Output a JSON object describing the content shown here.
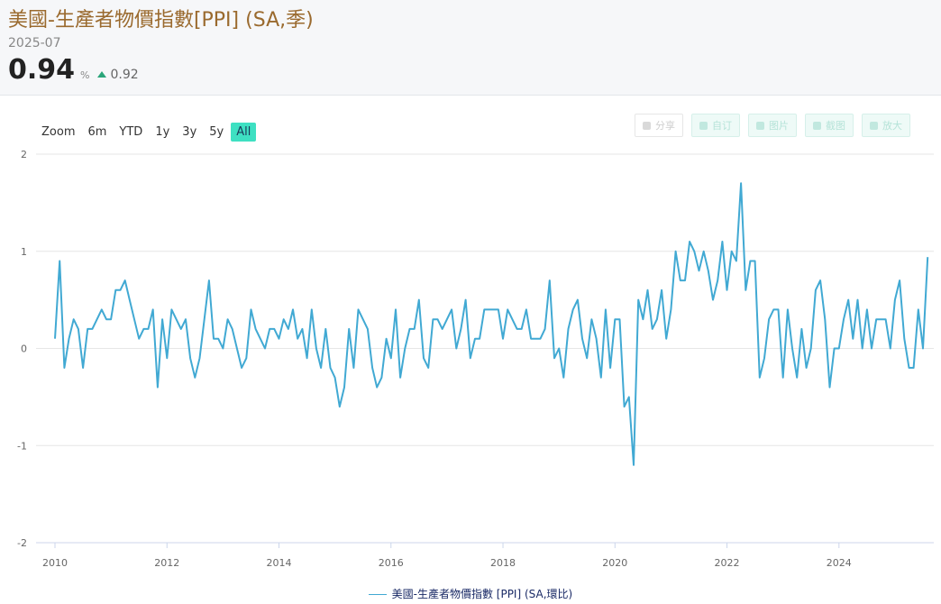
{
  "header": {
    "title": "美國-生產者物價指數[PPI] (SA,季)",
    "date": "2025-07",
    "value": "0.94",
    "unit": "%",
    "previous": "0.92",
    "trend_color": "#2aa57a"
  },
  "zoom": {
    "label": "Zoom",
    "options": [
      "6m",
      "YTD",
      "1y",
      "3y",
      "5y",
      "All"
    ],
    "active": "All"
  },
  "toolbar": {
    "share": "分享",
    "custom": "自订",
    "image": "图片",
    "screenshot": "截图",
    "enlarge": "放大"
  },
  "legend": {
    "label": "美國-生產者物價指數 [PPI] (SA,環比)"
  },
  "chart_data": {
    "type": "line",
    "title": "",
    "xlabel": "",
    "ylabel": "",
    "series_color": "#41a9d3",
    "xlim": [
      "2010-01",
      "2025-07"
    ],
    "ylim": [
      -2,
      2
    ],
    "x_ticks": [
      "2010",
      "2012",
      "2014",
      "2016",
      "2018",
      "2020",
      "2022",
      "2024"
    ],
    "y_ticks": [
      "2",
      "1",
      "0",
      "-1",
      "-2"
    ],
    "grid": "horizontal",
    "legend_position": "bottom-center",
    "series": [
      {
        "name": "美國-生產者物價指數 [PPI] (SA,環比)",
        "start": "2010-01",
        "frequency": "monthly",
        "values": [
          0.1,
          0.9,
          -0.2,
          0.1,
          0.3,
          0.2,
          -0.2,
          0.2,
          0.2,
          0.3,
          0.4,
          0.3,
          0.3,
          0.6,
          0.6,
          0.7,
          0.5,
          0.3,
          0.1,
          0.2,
          0.2,
          0.4,
          -0.4,
          0.3,
          -0.1,
          0.4,
          0.3,
          0.2,
          0.3,
          -0.1,
          -0.3,
          -0.1,
          0.3,
          0.7,
          0.1,
          0.1,
          0.0,
          0.3,
          0.2,
          0.0,
          -0.2,
          -0.1,
          0.4,
          0.2,
          0.1,
          0.0,
          0.2,
          0.2,
          0.1,
          0.3,
          0.2,
          0.4,
          0.1,
          0.2,
          -0.1,
          0.4,
          0.0,
          -0.2,
          0.2,
          -0.2,
          -0.3,
          -0.6,
          -0.4,
          0.2,
          -0.2,
          0.4,
          0.3,
          0.2,
          -0.2,
          -0.4,
          -0.3,
          0.1,
          -0.1,
          0.4,
          -0.3,
          0.0,
          0.2,
          0.2,
          0.5,
          -0.1,
          -0.2,
          0.3,
          0.3,
          0.2,
          0.3,
          0.4,
          0.0,
          0.2,
          0.5,
          -0.1,
          0.1,
          0.1,
          0.4,
          0.4,
          0.4,
          0.4,
          0.1,
          0.4,
          0.3,
          0.2,
          0.2,
          0.4,
          0.1,
          0.1,
          0.1,
          0.2,
          0.7,
          -0.1,
          0.0,
          -0.3,
          0.2,
          0.4,
          0.5,
          0.1,
          -0.1,
          0.3,
          0.1,
          -0.3,
          0.4,
          -0.2,
          0.3,
          0.3,
          -0.6,
          -0.5,
          -1.2,
          0.5,
          0.3,
          0.6,
          0.2,
          0.3,
          0.6,
          0.1,
          0.4,
          1.0,
          0.7,
          0.7,
          1.1,
          1.0,
          0.8,
          1.0,
          0.8,
          0.5,
          0.7,
          1.1,
          0.6,
          1.0,
          0.9,
          1.7,
          0.6,
          0.9,
          0.9,
          -0.3,
          -0.1,
          0.3,
          0.4,
          0.4,
          -0.3,
          0.4,
          0.0,
          -0.3,
          0.2,
          -0.2,
          0.0,
          0.6,
          0.7,
          0.3,
          -0.4,
          0.0,
          0.0,
          0.3,
          0.5,
          0.1,
          0.5,
          0.0,
          0.4,
          0.0,
          0.3,
          0.3,
          0.3,
          0.0,
          0.5,
          0.7,
          0.1,
          -0.2,
          -0.2,
          0.4,
          0.0,
          0.94
        ]
      }
    ]
  }
}
